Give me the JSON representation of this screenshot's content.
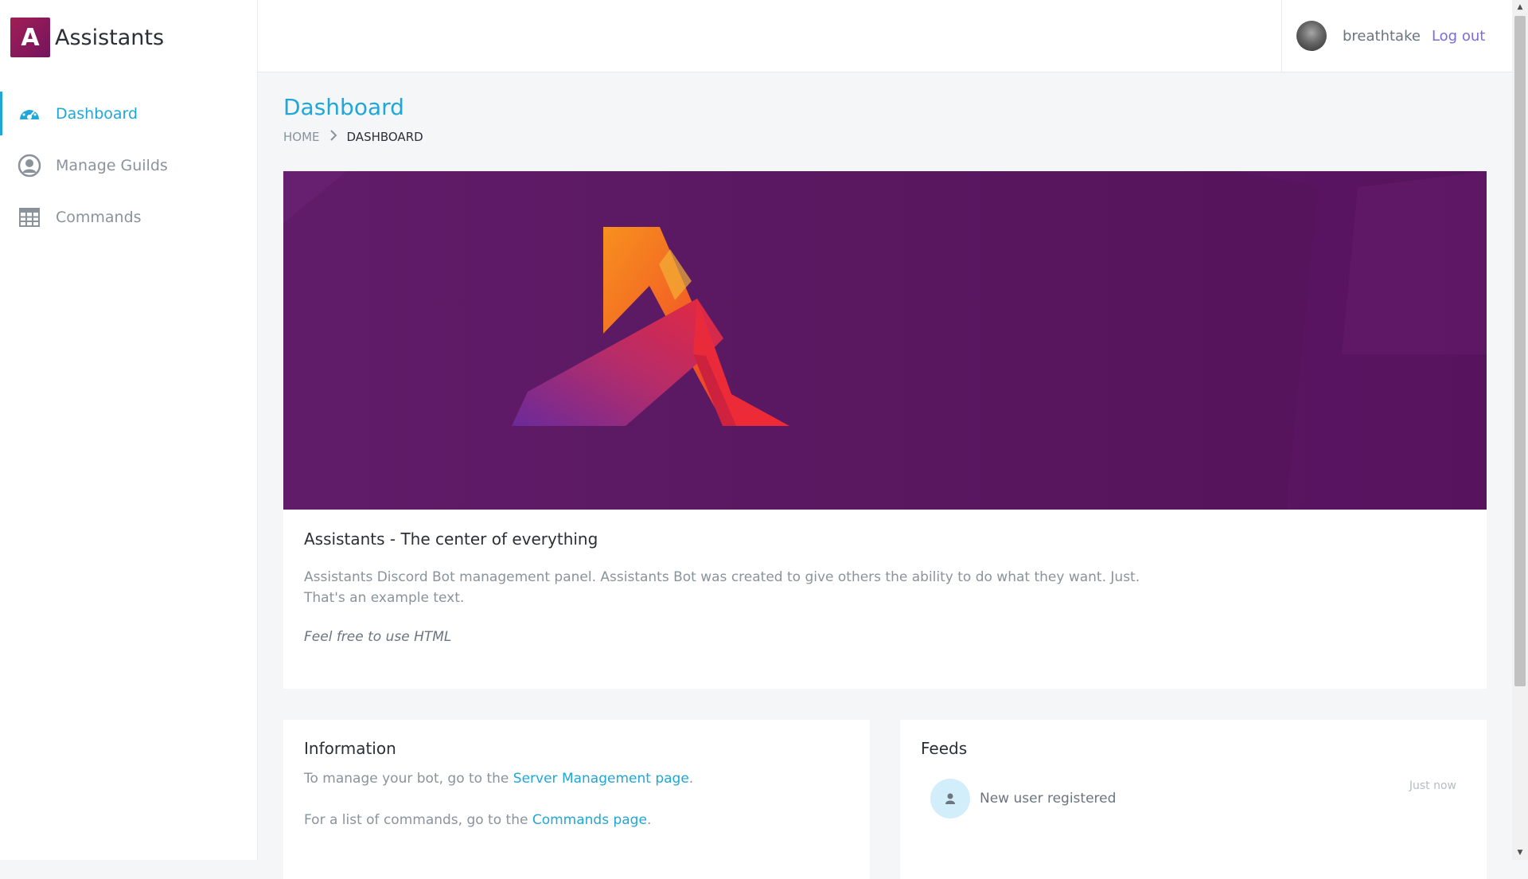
{
  "brand": {
    "logo_letter": "A",
    "name": "Assistants"
  },
  "sidebar": {
    "items": [
      {
        "label": "Dashboard",
        "icon": "dashboard-icon",
        "active": true
      },
      {
        "label": "Manage Guilds",
        "icon": "user-circle-icon",
        "active": false
      },
      {
        "label": "Commands",
        "icon": "table-icon",
        "active": false
      }
    ]
  },
  "header": {
    "username": "breathtake",
    "logout_label": "Log out"
  },
  "page": {
    "title": "Dashboard",
    "breadcrumb": {
      "home": "HOME",
      "current": "DASHBOARD"
    }
  },
  "hero": {
    "title": "Assistants - The center of everything",
    "description": "Assistants Discord Bot management panel. Assistants Bot was created to give others the ability to do what they want. Just. That's an example text.",
    "note": "Feel free to use HTML"
  },
  "information": {
    "title": "Information",
    "line1_prefix": "To manage your bot, go to the ",
    "line1_link": "Server Management page",
    "line1_suffix": ".",
    "line2_prefix": "For a list of commands, go to the ",
    "line2_link": "Commands page",
    "line2_suffix": "."
  },
  "feeds": {
    "title": "Feeds",
    "items": [
      {
        "text": "New user registered",
        "time": "Just now",
        "icon": "user-icon"
      }
    ]
  },
  "colors": {
    "accent": "#1fa7d8",
    "logout": "#7b6cd9",
    "banner": "#5a1861"
  }
}
